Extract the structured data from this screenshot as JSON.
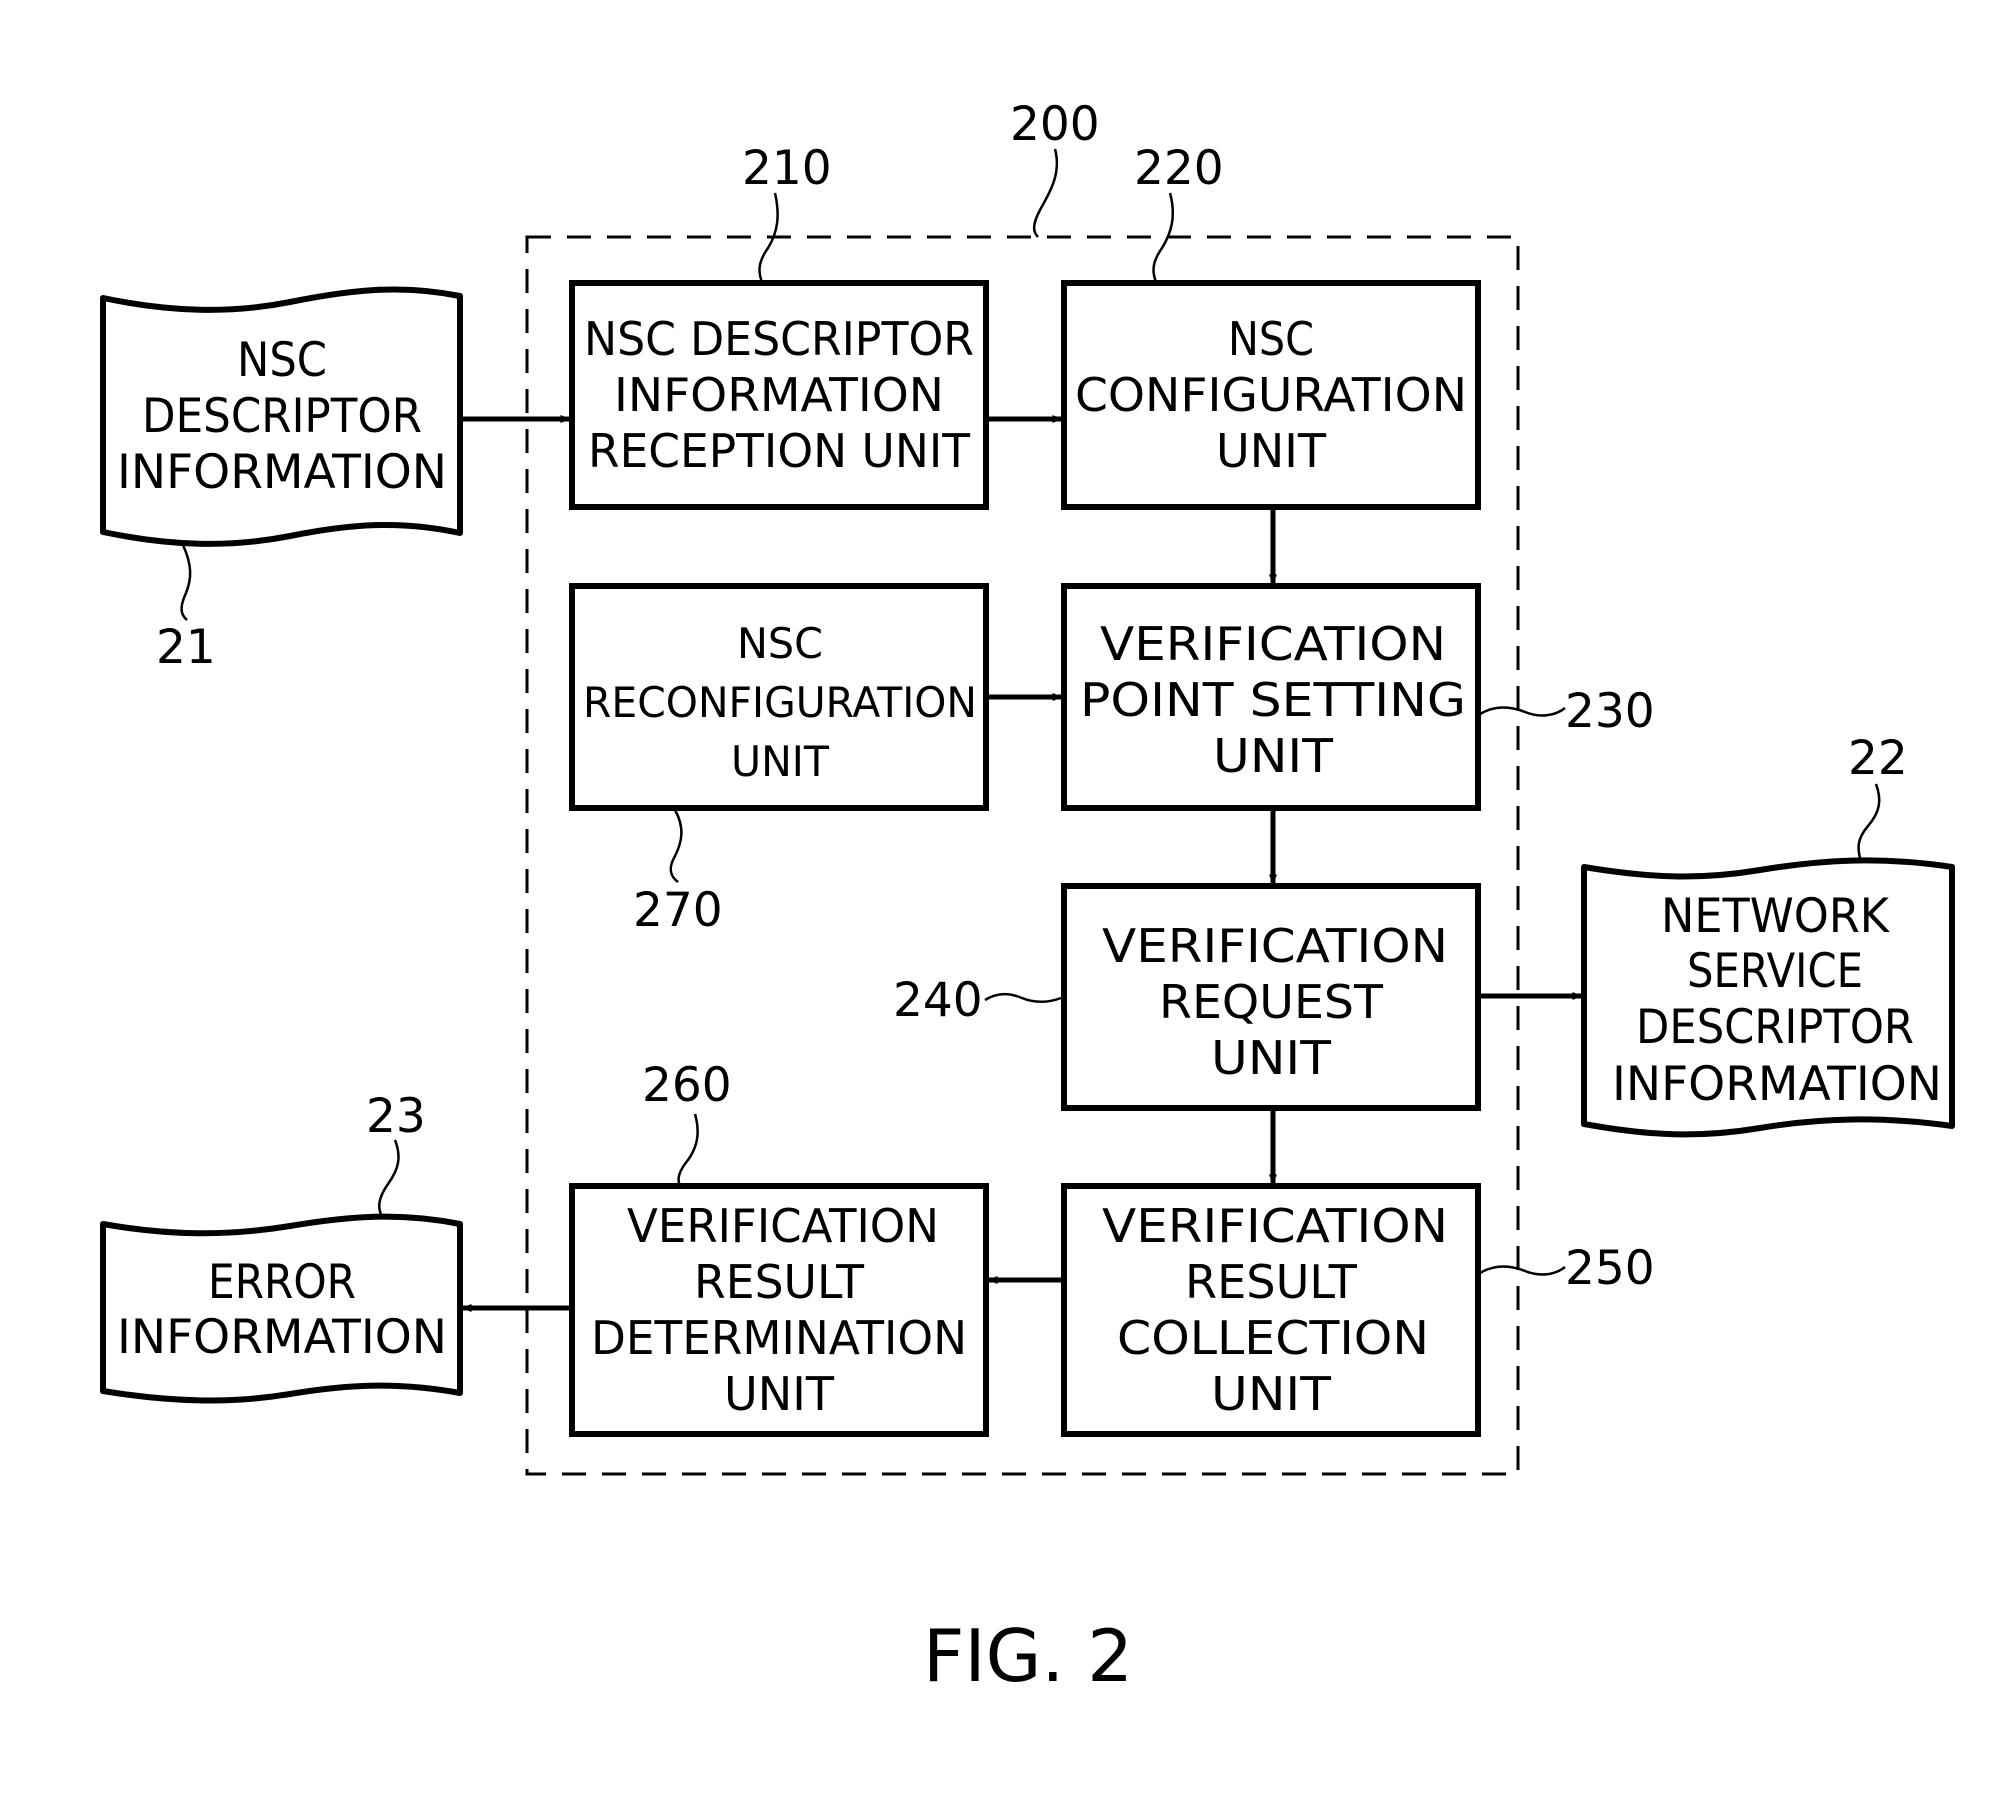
{
  "figure": {
    "caption": "FIG. 2",
    "system": {
      "ref": "200"
    },
    "units": [
      {
        "id": "210",
        "ref": "210",
        "lines": [
          "NSC DESCRIPTOR",
          "INFORMATION",
          "RECEPTION UNIT"
        ]
      },
      {
        "id": "220",
        "ref": "220",
        "lines": [
          "NSC",
          "CONFIGURATION",
          "UNIT"
        ]
      },
      {
        "id": "270",
        "ref": "270",
        "lines": [
          "NSC",
          "RECONFIGURATION",
          "UNIT"
        ]
      },
      {
        "id": "230",
        "ref": "230",
        "lines": [
          "VERIFICATION",
          "POINT SETTING",
          "UNIT"
        ]
      },
      {
        "id": "240",
        "ref": "240",
        "lines": [
          "VERIFICATION",
          "REQUEST",
          "UNIT"
        ]
      },
      {
        "id": "260",
        "ref": "260",
        "lines": [
          "VERIFICATION",
          "RESULT",
          "DETERMINATION",
          "UNIT"
        ]
      },
      {
        "id": "250",
        "ref": "250",
        "lines": [
          "VERIFICATION",
          "RESULT",
          "COLLECTION",
          "UNIT"
        ]
      }
    ],
    "documents": [
      {
        "id": "21",
        "ref": "21",
        "lines": [
          "NSC",
          "DESCRIPTOR",
          "INFORMATION"
        ]
      },
      {
        "id": "22",
        "ref": "22",
        "lines": [
          "NETWORK",
          "SERVICE",
          "DESCRIPTOR",
          "INFORMATION"
        ]
      },
      {
        "id": "23",
        "ref": "23",
        "lines": [
          "ERROR",
          "INFORMATION"
        ]
      }
    ],
    "connections": [
      {
        "from": "21",
        "to": "210"
      },
      {
        "from": "210",
        "to": "220"
      },
      {
        "from": "220",
        "to": "230"
      },
      {
        "from": "270",
        "to": "230"
      },
      {
        "from": "230",
        "to": "240"
      },
      {
        "from": "240",
        "to": "22"
      },
      {
        "from": "240",
        "to": "250"
      },
      {
        "from": "250",
        "to": "260"
      },
      {
        "from": "260",
        "to": "23"
      }
    ]
  }
}
